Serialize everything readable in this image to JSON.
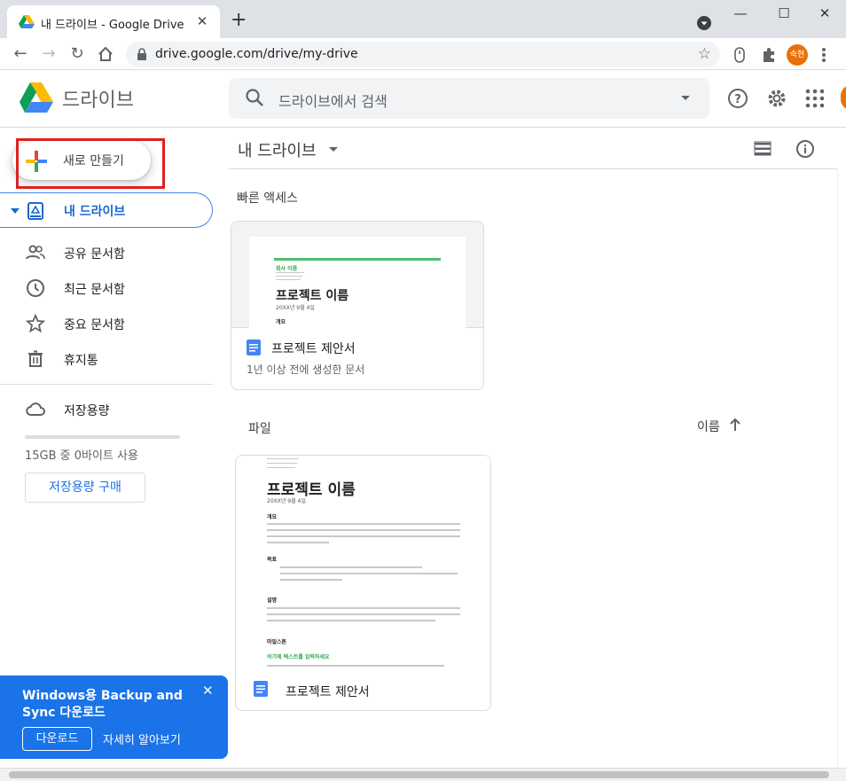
{
  "browser": {
    "tab_title": "내 드라이브 - Google Drive",
    "url": "drive.google.com/drive/my-drive",
    "profile_initials": "숙현"
  },
  "header": {
    "brand": "드라이브",
    "search_placeholder": "드라이브에서 검색"
  },
  "sidebar": {
    "new_button": "새로 만들기",
    "items": [
      {
        "label": "내 드라이브",
        "icon": "my-drive-icon",
        "active": true
      },
      {
        "label": "공유 문서함",
        "icon": "people-icon"
      },
      {
        "label": "최근 문서함",
        "icon": "clock-icon"
      },
      {
        "label": "중요 문서함",
        "icon": "star-icon"
      },
      {
        "label": "휴지통",
        "icon": "trash-icon"
      }
    ],
    "storage_label": "저장용량",
    "storage_usage": "15GB 중 0바이트 사용",
    "buy_storage": "저장용량 구매"
  },
  "main": {
    "title": "내 드라이브",
    "quick_access_label": "빠른 액세스",
    "quick_card": {
      "name": "프로젝트 제안서",
      "subtitle": "1년 이상 전에 생성한 문서",
      "preview_title": "프로젝트 이름",
      "preview_date": "20XX년 9월 4일",
      "preview_section": "개요",
      "preview_company": "회사 이름"
    },
    "files_label": "파일",
    "sort_label": "이름",
    "file_card": {
      "name": "프로젝트 제안서",
      "preview_title": "프로젝트 이름",
      "preview_date": "20XX년 9월 4일",
      "sections": [
        "개요",
        "목표",
        "설명",
        "마일스톤"
      ],
      "highlight": "여기에 텍스트를 입력하세요"
    }
  },
  "banner": {
    "message": "Windows용 Backup and Sync 다운로드",
    "download": "다운로드",
    "learn_more": "자세히 알아보기"
  },
  "colors": {
    "accent": "#1a73e8",
    "highlight_box": "#e02020",
    "profile": "#e8710a"
  }
}
